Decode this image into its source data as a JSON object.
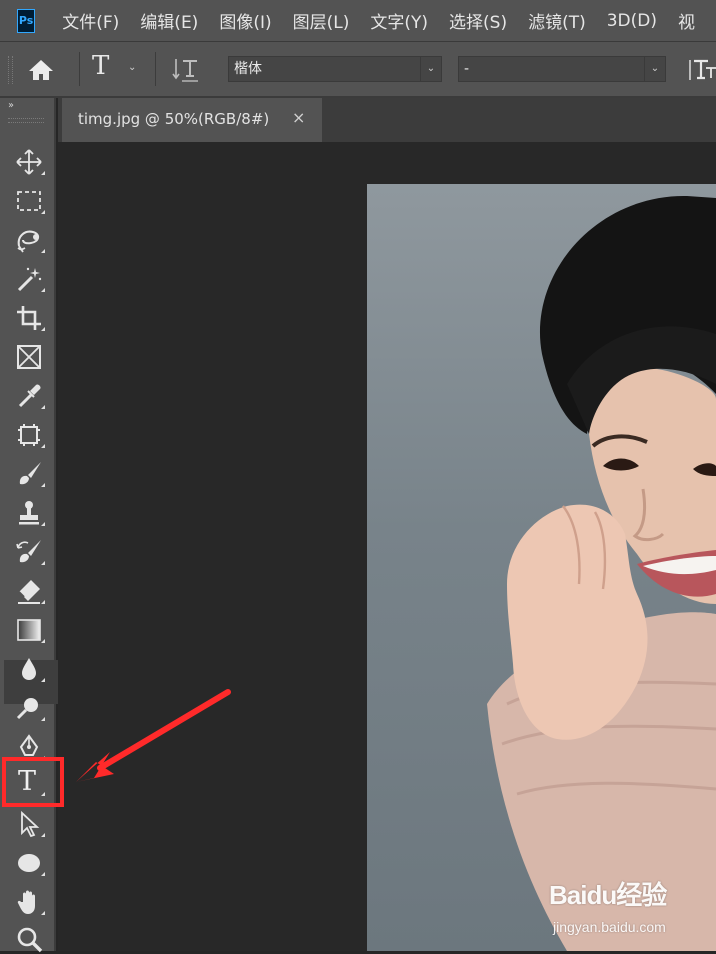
{
  "app": {
    "logo": "Ps"
  },
  "menu": [
    "文件(F)",
    "编辑(E)",
    "图像(I)",
    "图层(L)",
    "文字(Y)",
    "选择(S)",
    "滤镜(T)",
    "3D(D)",
    "视"
  ],
  "options_bar": {
    "icons": [
      "home-icon",
      "type-tool-icon",
      "chevron-down-icon",
      "text-orientation-icon",
      "font-size-icon"
    ],
    "font_family": "楷体",
    "font_style": "-"
  },
  "document": {
    "tab_title": "timg.jpg @ 50%(RGB/8#)",
    "close_glyph": "×"
  },
  "tools": [
    "move",
    "marquee",
    "lasso",
    "magic-wand",
    "crop",
    "frame",
    "eyedropper",
    "spot-healing",
    "brush",
    "clone-stamp",
    "history-brush",
    "eraser",
    "gradient",
    "blur",
    "dodge",
    "pen",
    "type",
    "path-selection",
    "ellipse",
    "hand",
    "zoom"
  ],
  "collapse_glyph": "››",
  "annotation": {
    "color": "#ff2a2a",
    "target": "type-tool"
  },
  "watermark": {
    "logo": "Baidu经验",
    "url": "jingyan.baidu.com"
  },
  "colors": {
    "panel": "#535353",
    "canvas": "#282828",
    "ps_blue": "#31a8ff"
  }
}
